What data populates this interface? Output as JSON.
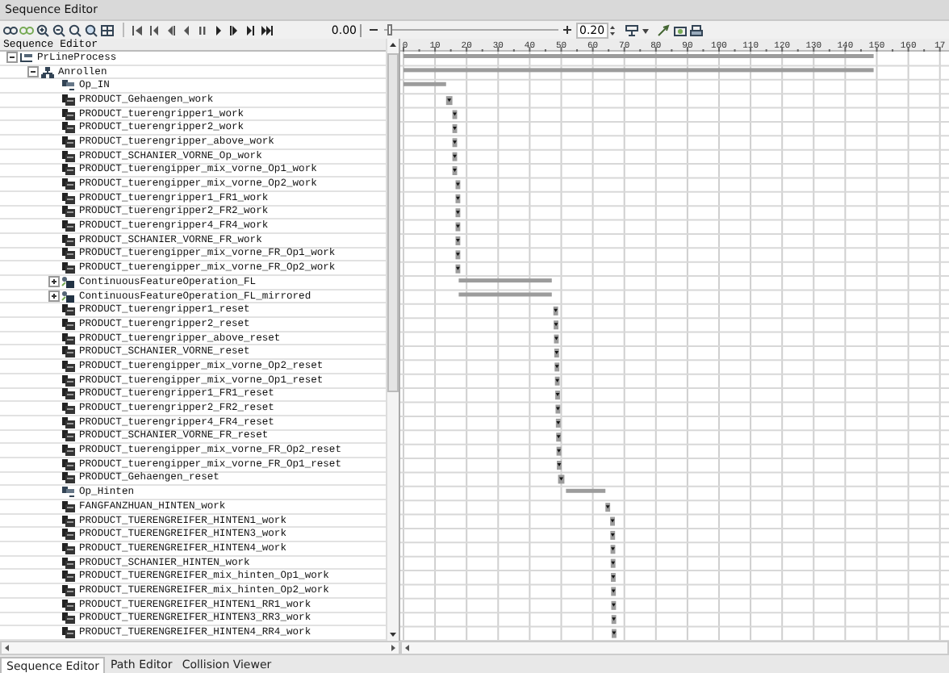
{
  "window": {
    "title": "Sequence Editor"
  },
  "toolbar": {
    "time": "0.00",
    "zoom_slider": {
      "level": 0.02
    },
    "step": "0.20"
  },
  "tree": {
    "header": "Sequence Editor",
    "items": [
      {
        "label": "PrLineProcess",
        "kind": "process",
        "expanded": true,
        "children": [
          {
            "label": "Anrollen",
            "kind": "compound",
            "expanded": true,
            "children": [
              {
                "label": "Op_IN",
                "kind": "operation"
              },
              {
                "label": "PRODUCT_Gehaengen_work",
                "kind": "product"
              },
              {
                "label": "PRODUCT_tuerengripper1_work",
                "kind": "product"
              },
              {
                "label": "PRODUCT_tuerengripper2_work",
                "kind": "product"
              },
              {
                "label": "PRODUCT_tuerengripper_above_work",
                "kind": "product"
              },
              {
                "label": "PRODUCT_SCHANIER_VORNE_Op_work",
                "kind": "product"
              },
              {
                "label": "PRODUCT_tuerengipper_mix_vorne_Op1_work",
                "kind": "product"
              },
              {
                "label": "PRODUCT_tuerengipper_mix_vorne_Op2_work",
                "kind": "product"
              },
              {
                "label": "PRODUCT_tuerengripper1_FR1_work",
                "kind": "product"
              },
              {
                "label": "PRODUCT_tuerengripper2_FR2_work",
                "kind": "product"
              },
              {
                "label": "PRODUCT_tuerengripper4_FR4_work",
                "kind": "product"
              },
              {
                "label": "PRODUCT_SCHANIER_VORNE_FR_work",
                "kind": "product"
              },
              {
                "label": "PRODUCT_tuerengipper_mix_vorne_FR_Op1_work",
                "kind": "product"
              },
              {
                "label": "PRODUCT_tuerengipper_mix_vorne_FR_Op2_work",
                "kind": "product"
              },
              {
                "label": "ContinuousFeatureOperation_FL",
                "kind": "feature",
                "expanded": false
              },
              {
                "label": "ContinuousFeatureOperation_FL_mirrored",
                "kind": "feature",
                "expanded": false
              },
              {
                "label": "PRODUCT_tuerengripper1_reset",
                "kind": "product"
              },
              {
                "label": "PRODUCT_tuerengripper2_reset",
                "kind": "product"
              },
              {
                "label": "PRODUCT_tuerengripper_above_reset",
                "kind": "product"
              },
              {
                "label": "PRODUCT_SCHANIER_VORNE_reset",
                "kind": "product"
              },
              {
                "label": "PRODUCT_tuerengipper_mix_vorne_Op2_reset",
                "kind": "product"
              },
              {
                "label": "PRODUCT_tuerengipper_mix_vorne_Op1_reset",
                "kind": "product"
              },
              {
                "label": "PRODUCT_tuerengripper1_FR1_reset",
                "kind": "product"
              },
              {
                "label": "PRODUCT_tuerengripper2_FR2_reset",
                "kind": "product"
              },
              {
                "label": "PRODUCT_tuerengripper4_FR4_reset",
                "kind": "product"
              },
              {
                "label": "PRODUCT_SCHANIER_VORNE_FR_reset",
                "kind": "product"
              },
              {
                "label": "PRODUCT_tuerengipper_mix_vorne_FR_Op2_reset",
                "kind": "product"
              },
              {
                "label": "PRODUCT_tuerengipper_mix_vorne_FR_Op1_reset",
                "kind": "product"
              },
              {
                "label": "PRODUCT_Gehaengen_reset",
                "kind": "product"
              },
              {
                "label": "Op_Hinten",
                "kind": "operation"
              },
              {
                "label": "FANGFANZHUAN_HINTEN_work",
                "kind": "product"
              },
              {
                "label": "PRODUCT_TUERENGREIFER_HINTEN1_work",
                "kind": "product"
              },
              {
                "label": "PRODUCT_TUERENGREIFER_HINTEN3_work",
                "kind": "product"
              },
              {
                "label": "PRODUCT_TUERENGREIFER_HINTEN4_work",
                "kind": "product"
              },
              {
                "label": "PRODUCT_SCHANIER_HINTEN_work",
                "kind": "product"
              },
              {
                "label": "PRODUCT_TUERENGREIFER_mix_hinten_Op1_work",
                "kind": "product"
              },
              {
                "label": "PRODUCT_TUERENGREIFER_mix_hinten_Op2_work",
                "kind": "product"
              },
              {
                "label": "PRODUCT_TUERENGREIFER_HINTEN1_RR1_work",
                "kind": "product"
              },
              {
                "label": "PRODUCT_TUERENGREIFER_HINTEN3_RR3_work",
                "kind": "product"
              },
              {
                "label": "PRODUCT_TUERENGREIFER_HINTEN4_RR4_work",
                "kind": "product"
              }
            ]
          }
        ]
      }
    ]
  },
  "timeline": {
    "ruler": [
      "0",
      "10",
      "20",
      "30",
      "40",
      "50",
      "60",
      "70",
      "80",
      "90",
      "100",
      "110",
      "120",
      "130",
      "140",
      "150",
      "160",
      "17"
    ]
  },
  "tabs": [
    {
      "label": "Sequence Editor",
      "selected": true
    },
    {
      "label": "Path Editor",
      "selected": false
    },
    {
      "label": "Collision Viewer",
      "selected": false
    }
  ]
}
